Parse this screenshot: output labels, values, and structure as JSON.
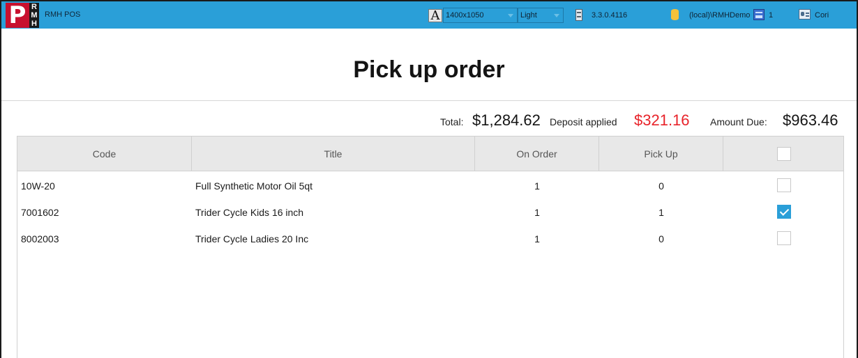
{
  "app": {
    "name": "RMH POS",
    "logo_letters": [
      "R",
      "M",
      "H"
    ],
    "logo_main": "P"
  },
  "toolbar": {
    "font_icon": "A",
    "resolution": "1400x1050",
    "theme": "Light",
    "version": "3.3.0.4116",
    "database": "(local)\\RMHDemo",
    "register": "1",
    "user": "Cori"
  },
  "page": {
    "title": "Pick up order"
  },
  "totals": {
    "total_label": "Total:",
    "total_value": "$1,284.62",
    "deposit_label": "Deposit applied",
    "deposit_value": "$321.16",
    "due_label": "Amount Due:",
    "due_value": "$963.46"
  },
  "grid": {
    "headers": {
      "code": "Code",
      "title": "Title",
      "on_order": "On Order",
      "pick_up": "Pick Up"
    },
    "rows": [
      {
        "code": "10W-20",
        "title": "Full Synthetic Motor Oil 5qt",
        "on_order": "1",
        "pick_up": "0",
        "checked": false
      },
      {
        "code": "7001602",
        "title": "Trider Cycle Kids 16 inch",
        "on_order": "1",
        "pick_up": "1",
        "checked": true
      },
      {
        "code": "8002003",
        "title": "Trider Cycle Ladies 20 Inc",
        "on_order": "1",
        "pick_up": "0",
        "checked": false
      }
    ]
  },
  "colors": {
    "topbar": "#2a9fd8",
    "accent": "#2a9fd8",
    "deposit": "#e8232a",
    "logo_red": "#c8102e"
  }
}
